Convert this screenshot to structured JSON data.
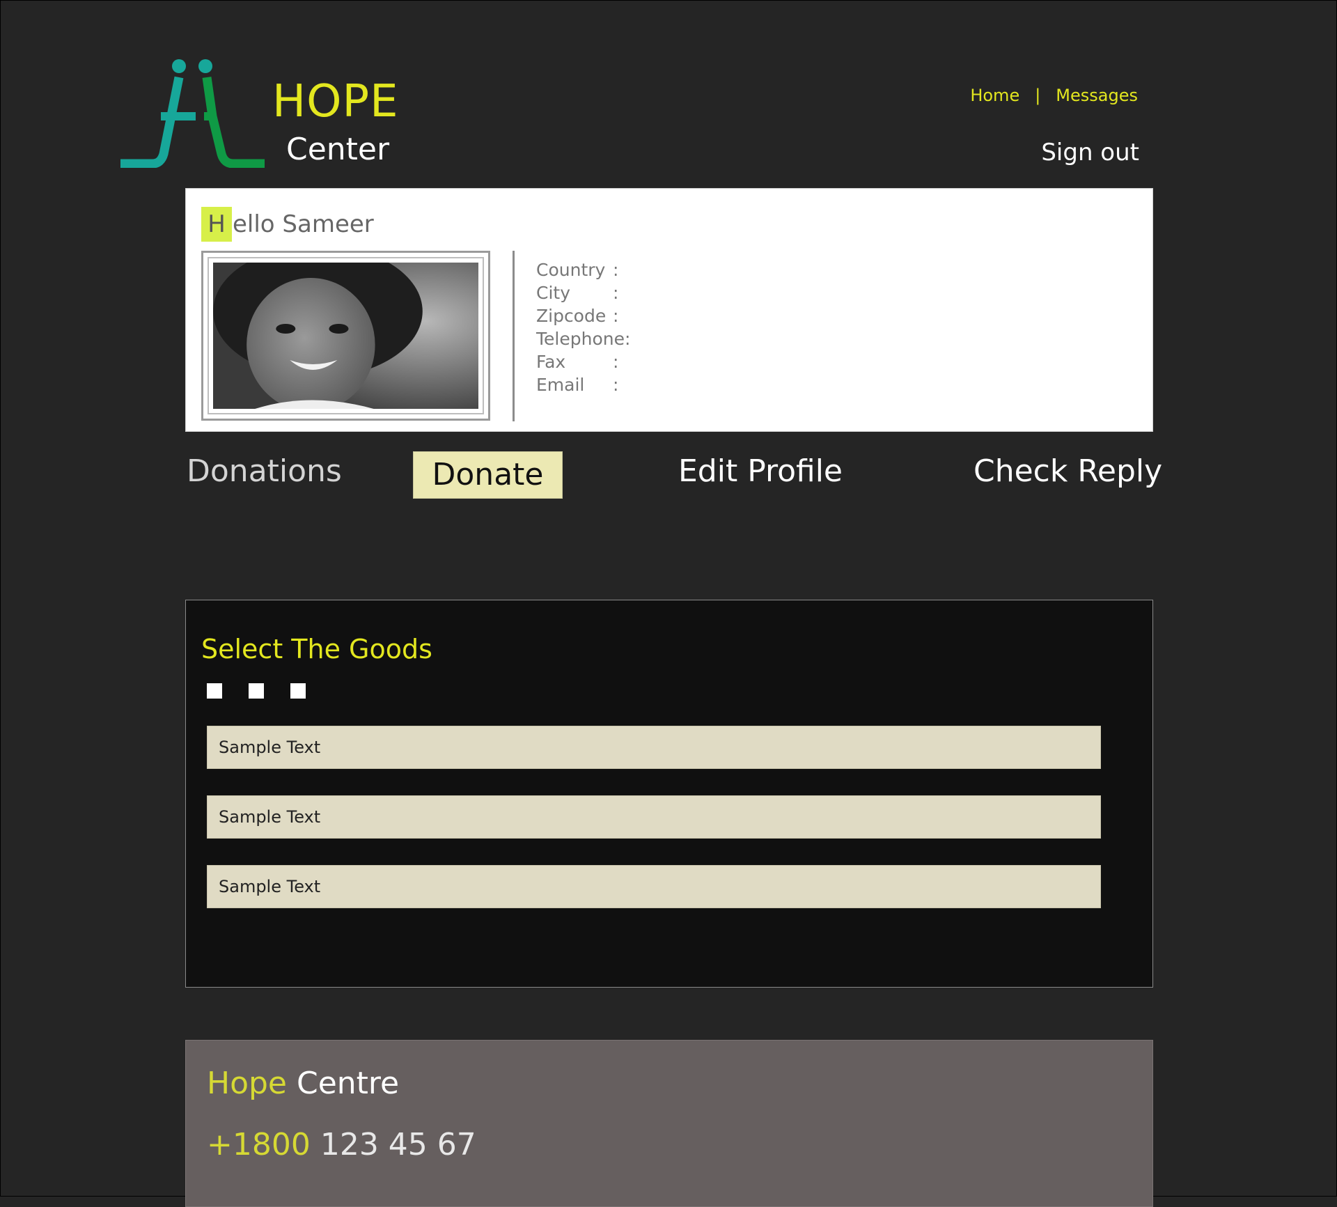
{
  "brand": {
    "name_line1": "HOPE",
    "name_line2": "Center"
  },
  "nav": {
    "home": "Home",
    "separator": "|",
    "messages": "Messages",
    "sign_out": "Sign out"
  },
  "profile": {
    "greeting_initial": "H",
    "greeting_rest": "ello Sameer",
    "fields": [
      {
        "label": "Country",
        "colon": ":"
      },
      {
        "label": "City",
        "colon": ":"
      },
      {
        "label": "Zipcode",
        "colon": ":"
      },
      {
        "label": "Telephone:",
        "colon": ""
      },
      {
        "label": "Fax",
        "colon": ":"
      },
      {
        "label": "Email",
        "colon": ":"
      }
    ]
  },
  "actions": {
    "donations": "Donations",
    "donate": "Donate",
    "edit_profile": "Edit Profile",
    "check_reply": "Check Reply"
  },
  "goods": {
    "title": "Select The Goods",
    "fields": [
      {
        "value": "Sample Text"
      },
      {
        "value": "Sample Text"
      },
      {
        "value": "Sample Text"
      }
    ]
  },
  "footer": {
    "brand_highlight": "Hope",
    "brand_rest": " Centre",
    "phone_prefix": "+1800",
    "phone_rest": " 123 45 67"
  },
  "colors": {
    "background": "#252525",
    "accent_yellow": "#e3e71f",
    "logo_teal": "#17a79a",
    "logo_green": "#0f9a45",
    "donate_button": "#ece9b3",
    "field_fill": "#e0dbc4",
    "footer_fill": "#665f5f"
  },
  "icons": {
    "logo": "two-people-logo-icon",
    "avatar": "child-portrait-photo"
  }
}
